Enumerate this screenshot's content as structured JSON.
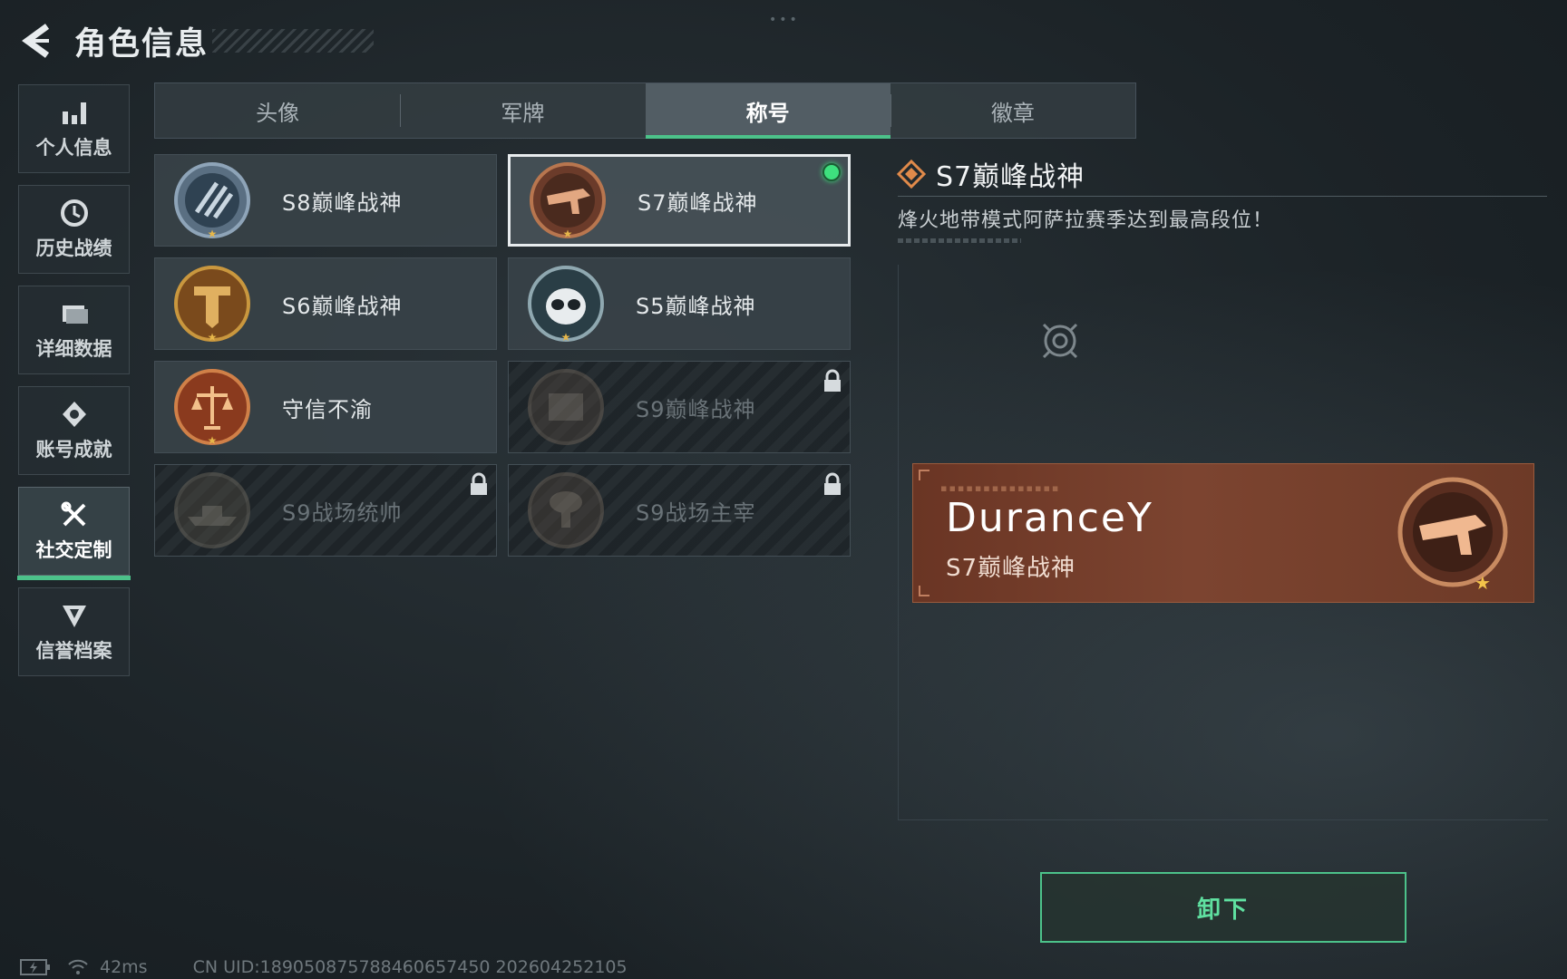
{
  "header": {
    "title": "角色信息"
  },
  "sidebar": {
    "items": [
      {
        "label": "个人信息",
        "icon": "bar-chart-icon"
      },
      {
        "label": "历史战绩",
        "icon": "history-icon"
      },
      {
        "label": "详细数据",
        "icon": "folder-icon"
      },
      {
        "label": "账号成就",
        "icon": "achievement-icon"
      },
      {
        "label": "社交定制",
        "icon": "tools-icon",
        "active": true
      },
      {
        "label": "信誉档案",
        "icon": "credit-icon"
      }
    ]
  },
  "tabs": [
    {
      "label": "头像"
    },
    {
      "label": "军牌"
    },
    {
      "label": "称号",
      "active": true
    },
    {
      "label": "徽章"
    }
  ],
  "titles": [
    {
      "label": "S8巅峰战神",
      "badge": "s8-badge-icon",
      "locked": false
    },
    {
      "label": "S7巅峰战神",
      "badge": "s7-badge-icon",
      "locked": false,
      "selected": true,
      "equipped": true
    },
    {
      "label": "S6巅峰战神",
      "badge": "s6-badge-icon",
      "locked": false
    },
    {
      "label": "S5巅峰战神",
      "badge": "s5-badge-icon",
      "locked": false
    },
    {
      "label": "守信不渝",
      "badge": "scales-badge-icon",
      "locked": false
    },
    {
      "label": "S9巅峰战神",
      "badge": "s9-badge-icon",
      "locked": true
    },
    {
      "label": "S9战场统帅",
      "badge": "ship-badge-icon",
      "locked": true
    },
    {
      "label": "S9战场主宰",
      "badge": "nuke-badge-icon",
      "locked": true
    }
  ],
  "detail": {
    "name": "S7巅峰战神",
    "description": "烽火地带模式阿萨拉赛季达到最高段位！"
  },
  "name_card": {
    "player": "DuranceY",
    "title": "S7巅峰战神"
  },
  "actions": {
    "unequip_label": "卸下"
  },
  "status": {
    "ping": "42ms",
    "uid": "CN UID:18905087578846065745​0 202604252105"
  },
  "colors": {
    "accent_green": "#4cc28a",
    "card_copper": "#7c4430",
    "background": "#1c2327"
  }
}
